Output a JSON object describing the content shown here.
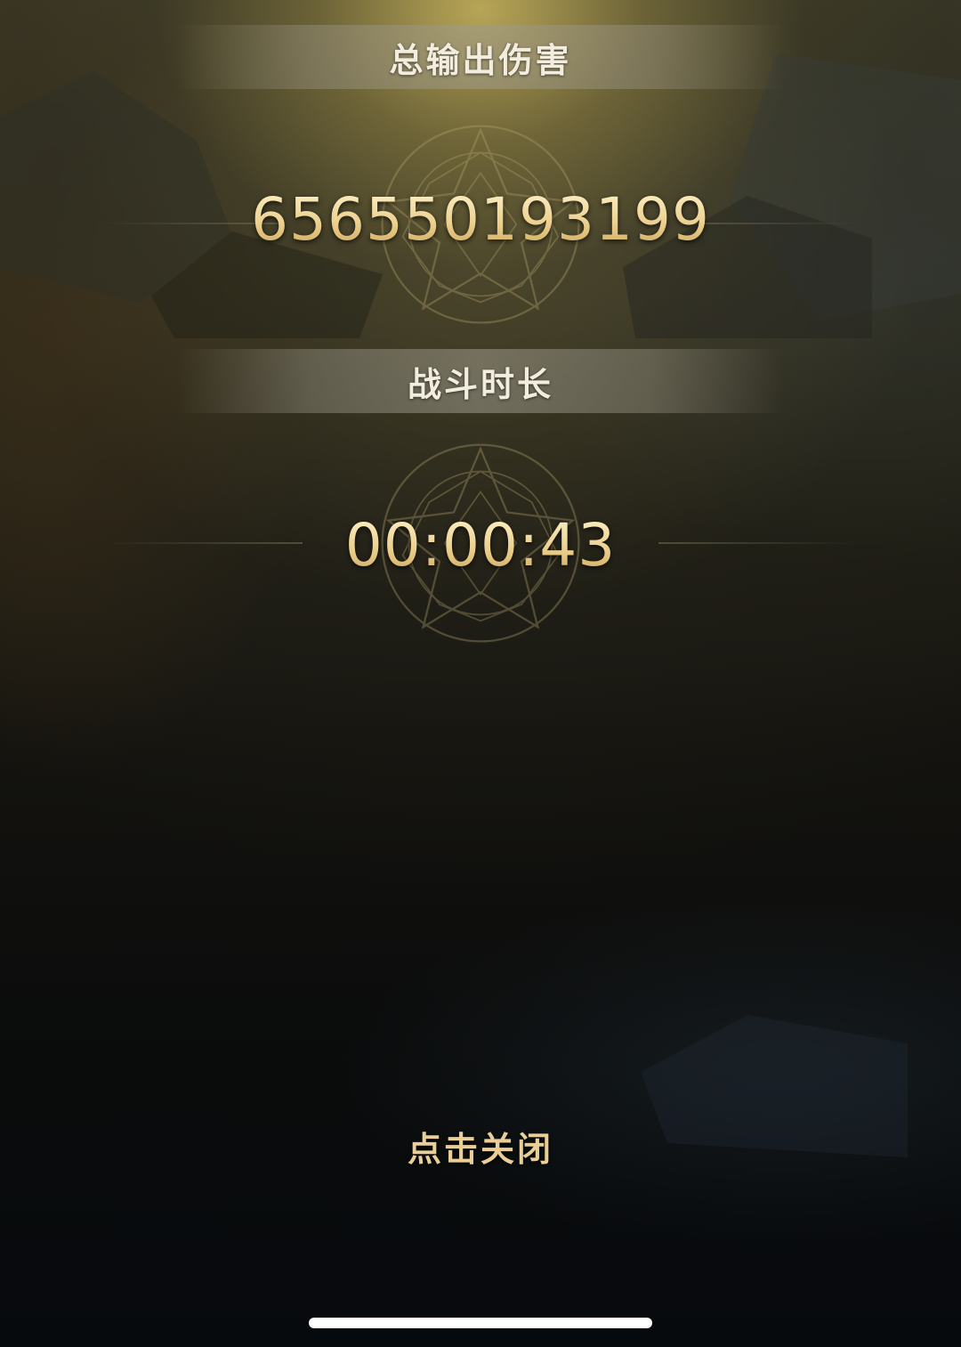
{
  "damage_section": {
    "title": "总输出伤害",
    "value": "656550193199"
  },
  "duration_section": {
    "title": "战斗时长",
    "value": "00:00:43"
  },
  "close_label": "点击关闭",
  "colors": {
    "gold_text": "#ecd08e",
    "banner_text": "#f3ede0",
    "background": "#07090b"
  },
  "icons": [
    "nine-point-star-emblem-icon"
  ]
}
